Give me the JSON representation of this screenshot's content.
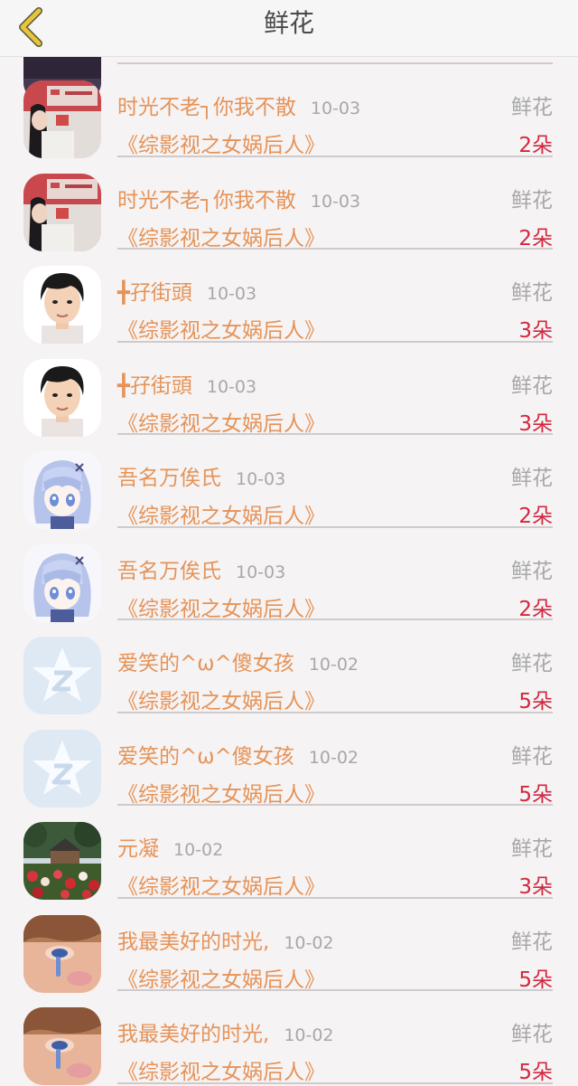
{
  "header": {
    "title": "鲜花",
    "back_icon": "chevron-left-icon",
    "back_color": "#e8c43c"
  },
  "list": [
    {
      "avatar": "girl-photo-avatar",
      "name": "时光不老┐你我不散",
      "date": "10-03",
      "type": "鲜花",
      "book": "《综影视之女娲后人》",
      "count": "2朵"
    },
    {
      "avatar": "girl-photo-avatar",
      "name": "时光不老┐你我不散",
      "date": "10-03",
      "type": "鲜花",
      "book": "《综影视之女娲后人》",
      "count": "2朵"
    },
    {
      "avatar": "boy-avatar",
      "name": "╋孖街頭",
      "date": "10-03",
      "type": "鲜花",
      "book": "《综影视之女娲后人》",
      "count": "3朵"
    },
    {
      "avatar": "boy-avatar",
      "name": "╋孖街頭",
      "date": "10-03",
      "type": "鲜花",
      "book": "《综影视之女娲后人》",
      "count": "3朵"
    },
    {
      "avatar": "anime-girl-avatar",
      "name": "吾名万俟氏",
      "date": "10-03",
      "type": "鲜花",
      "book": "《综影视之女娲后人》",
      "count": "2朵"
    },
    {
      "avatar": "anime-girl-avatar",
      "name": "吾名万俟氏",
      "date": "10-03",
      "type": "鲜花",
      "book": "《综影视之女娲后人》",
      "count": "2朵"
    },
    {
      "avatar": "qq-default-avatar",
      "name": "爱笑的^ω^傻女孩",
      "date": "10-02",
      "type": "鲜花",
      "book": "《综影视之女娲后人》",
      "count": "5朵"
    },
    {
      "avatar": "qq-default-avatar",
      "name": "爱笑的^ω^傻女孩",
      "date": "10-02",
      "type": "鲜花",
      "book": "《综影视之女娲后人》",
      "count": "5朵"
    },
    {
      "avatar": "garden-house-avatar",
      "name": "元凝",
      "date": "10-02",
      "type": "鲜花",
      "book": "《综影视之女娲后人》",
      "count": "3朵"
    },
    {
      "avatar": "crying-face-avatar",
      "name": "我最美好的时光,",
      "date": "10-02",
      "type": "鲜花",
      "book": "《综影视之女娲后人》",
      "count": "5朵"
    },
    {
      "avatar": "crying-face-avatar",
      "name": "我最美好的时光,",
      "date": "10-02",
      "type": "鲜花",
      "book": "《综影视之女娲后人》",
      "count": "5朵"
    }
  ],
  "colors": {
    "name": "#e59358",
    "muted": "#a8a8a8",
    "count": "#d1283f",
    "divider": "#cfcbcd"
  }
}
